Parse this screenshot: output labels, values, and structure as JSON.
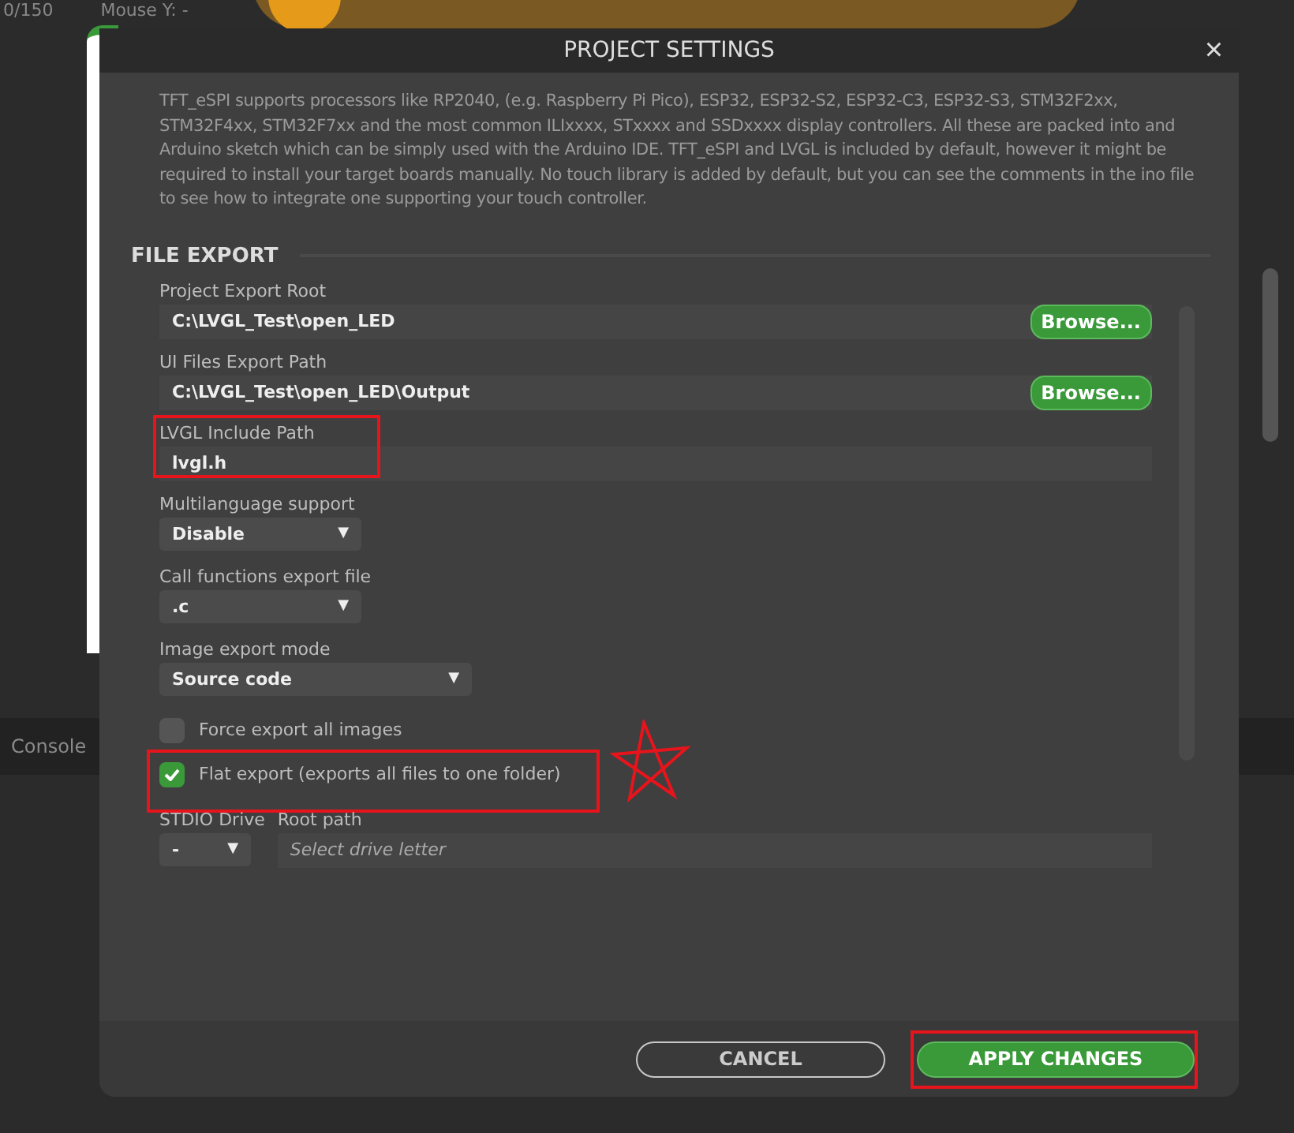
{
  "app": {
    "counter": "0/150",
    "mouse_label": "Mouse Y: -",
    "console_tab": "Console"
  },
  "dialog": {
    "title": "PROJECT SETTINGS",
    "close": "×",
    "description": "TFT_eSPI supports processors like RP2040, (e.g. Raspberry Pi Pico), ESP32, ESP32-S2, ESP32-C3, ESP32-S3, STM32F2xx, STM32F4xx, STM32F7xx and the most common ILIxxxx, STxxxx and SSDxxxx display controllers. All these are packed into and Arduino sketch which can be simply used with the Arduino IDE. TFT_eSPI and LVGL is included by default, however it might be required to install your target boards manually.  No touch library is added by default, but you can see the comments in the ino file to see how to integrate one supporting your touch controller.",
    "section": "FILE EXPORT",
    "fields": [
      {
        "kind": "path",
        "label": "Project Export Root",
        "value": "C:\\LVGL_Test\\open_LED",
        "button": "Browse..."
      },
      {
        "kind": "path",
        "label": "UI Files Export Path",
        "value": "C:\\LVGL_Test\\open_LED\\Output",
        "button": "Browse..."
      },
      {
        "kind": "text",
        "label": "LVGL Include Path",
        "value": "lvgl.h",
        "highlighted": true
      },
      {
        "kind": "dropdown",
        "label": "Multilanguage support",
        "value": "Disable",
        "caret": "▼",
        "wide": false
      },
      {
        "kind": "dropdown",
        "label": "Call functions export file",
        "value": ".c",
        "caret": "▼",
        "wide": false
      },
      {
        "kind": "dropdown",
        "label": "Image export mode",
        "value": "Source code",
        "caret": "▼",
        "wide": true
      },
      {
        "kind": "checkbox",
        "label": "Force export all images",
        "checked": false,
        "highlighted": false
      },
      {
        "kind": "checkbox",
        "label": "Flat export (exports all files to one folder)",
        "checked": true,
        "highlighted": true
      },
      {
        "kind": "drive",
        "label": "STDIO Drive",
        "value": "-",
        "caret": "▼",
        "path_label": "Root path",
        "placeholder": "Select drive letter"
      }
    ],
    "buttons": [
      {
        "kind": "secondary",
        "label": "CANCEL",
        "highlighted": false
      },
      {
        "kind": "primary",
        "label": "APPLY CHANGES",
        "highlighted": true
      }
    ]
  }
}
